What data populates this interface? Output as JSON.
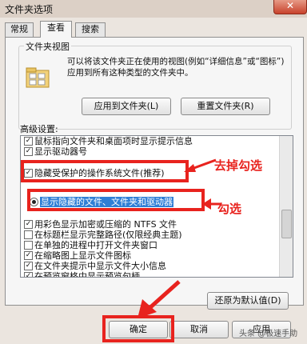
{
  "window": {
    "title": "文件夹选项",
    "close_glyph": "✕"
  },
  "tabs": [
    {
      "label": "常规",
      "active": false
    },
    {
      "label": "查看",
      "active": true
    },
    {
      "label": "搜索",
      "active": false
    }
  ],
  "folder_views": {
    "group_label": "文件夹视图",
    "description": "可以将该文件夹正在使用的视图(例如“详细信息”或“图标”)应用到所有这种类型的文件夹中。",
    "apply_button": "应用到文件夹(L)",
    "reset_button": "重置文件夹(R)"
  },
  "advanced": {
    "label": "高级设置:",
    "items": [
      {
        "label": "鼠标指向文件夹和桌面项时显示提示信息",
        "type": "checkbox",
        "checked": true
      },
      {
        "label": "显示驱动器号",
        "type": "checkbox",
        "checked": true
      },
      {
        "label": "隐藏受保护的操作系统文件(推荐)",
        "type": "checkbox",
        "checked": true
      },
      {
        "label": "显示隐藏的文件、文件夹和驱动器",
        "type": "radio",
        "checked": true
      },
      {
        "label": "用彩色显示加密或压缩的 NTFS 文件",
        "type": "checkbox",
        "checked": true
      },
      {
        "label": "在标题栏显示完整路径(仅限经典主题)",
        "type": "checkbox",
        "checked": false
      },
      {
        "label": "在单独的进程中打开文件夹窗口",
        "type": "checkbox",
        "checked": false
      },
      {
        "label": "在缩略图上显示文件图标",
        "type": "checkbox",
        "checked": true
      },
      {
        "label": "在文件夹提示中显示文件大小信息",
        "type": "checkbox",
        "checked": true
      },
      {
        "label": "在预览窗格中显示预览句柄",
        "type": "checkbox",
        "checked": true
      }
    ],
    "restore_button": "还原为默认值(D)"
  },
  "annotations": {
    "uncheck": "去掉勾选",
    "check": "勾选"
  },
  "footer": {
    "ok": "确定",
    "cancel": "取消",
    "apply": "应用"
  },
  "watermark": "头条 @极速手助",
  "colors": {
    "annotation": "#e8231e",
    "selection": "#2f7fd6"
  }
}
